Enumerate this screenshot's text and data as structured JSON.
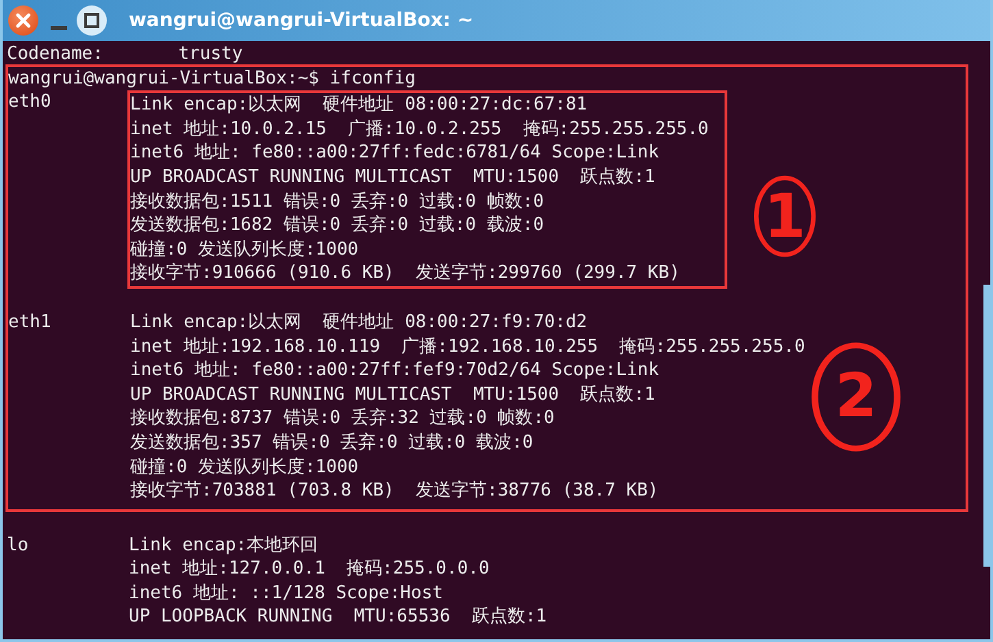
{
  "window": {
    "title": "wangrui@wangrui-VirtualBox: ~"
  },
  "terminal": {
    "lines_before": [
      "Codename:       trusty"
    ],
    "highlighted_section": {
      "prompt": "wangrui@wangrui-VirtualBox:~$ ifconfig",
      "interfaces": [
        {
          "name": "eth0",
          "boxed": true,
          "note": "1",
          "lines": [
            "Link encap:以太网  硬件地址 08:00:27:dc:67:81",
            "inet 地址:10.0.2.15  广播:10.0.2.255  掩码:255.255.255.0",
            "inet6 地址: fe80::a00:27ff:fedc:6781/64 Scope:Link",
            "UP BROADCAST RUNNING MULTICAST  MTU:1500  跃点数:1",
            "接收数据包:1511 错误:0 丢弃:0 过载:0 帧数:0",
            "发送数据包:1682 错误:0 丢弃:0 过载:0 载波:0",
            "碰撞:0 发送队列长度:1000",
            "接收字节:910666 (910.6 KB)  发送字节:299760 (299.7 KB)"
          ]
        },
        {
          "name": "eth1",
          "boxed": false,
          "note": "2",
          "lines": [
            "Link encap:以太网  硬件地址 08:00:27:f9:70:d2",
            "inet 地址:192.168.10.119  广播:192.168.10.255  掩码:255.255.255.0",
            "inet6 地址: fe80::a00:27ff:fef9:70d2/64 Scope:Link",
            "UP BROADCAST RUNNING MULTICAST  MTU:1500  跃点数:1",
            "接收数据包:8737 错误:0 丢弃:32 过载:0 帧数:0",
            "发送数据包:357 错误:0 丢弃:0 过载:0 载波:0",
            "碰撞:0 发送队列长度:1000",
            "接收字节:703881 (703.8 KB)  发送字节:38776 (38.7 KB)"
          ]
        }
      ]
    },
    "interfaces_after": [
      {
        "name": "lo",
        "lines": [
          "Link encap:本地环回",
          "inet 地址:127.0.0.1  掩码:255.0.0.0",
          "inet6 地址: ::1/128 Scope:Host",
          "UP LOOPBACK RUNNING  MTU:65536  跃点数:1"
        ]
      }
    ]
  }
}
